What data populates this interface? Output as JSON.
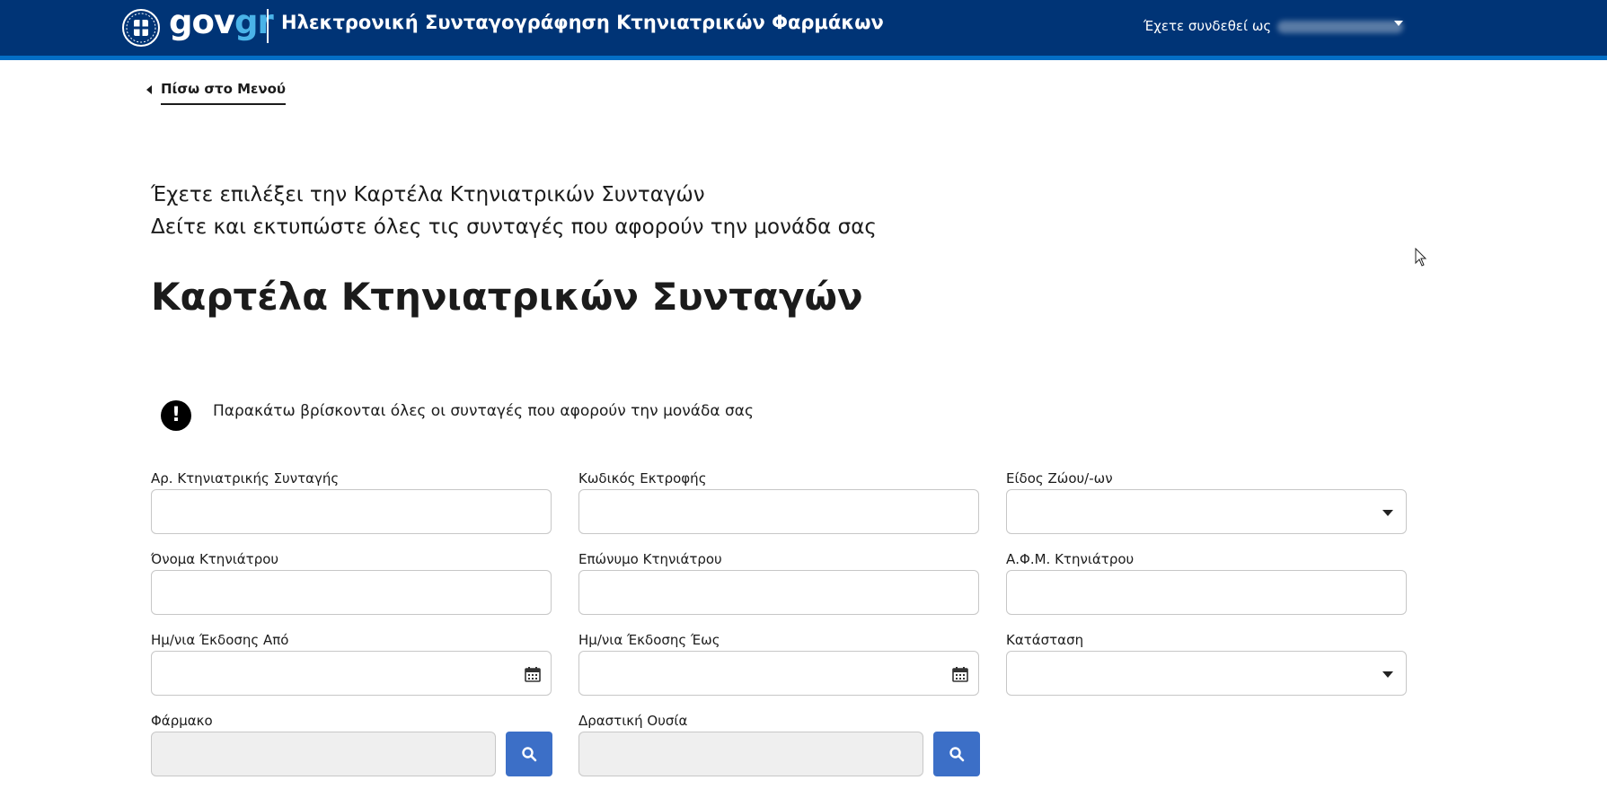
{
  "header": {
    "brand_gov": "gov",
    "brand_gr": "gr",
    "app_title": "Ηλεκτρονική Συνταγογράφηση Κτηνιατρικών Φαρμάκων",
    "signed_in_label": "Έχετε συνδεθεί ως",
    "colors": {
      "bar": "#003476",
      "strip": "#046ec5"
    }
  },
  "nav": {
    "back_label": "Πίσω στο Μενού"
  },
  "intro": {
    "line1": "Έχετε επιλέξει την Καρτέλα Κτηνιατρικών Συνταγών",
    "line2": "Δείτε και εκτυπώστε όλες τις συνταγές που αφορούν την μονάδα σας"
  },
  "page_title": "Καρτέλα Κτηνιατρικών Συνταγών",
  "notice": {
    "icon": "exclamation-icon",
    "text": "Παρακάτω βρίσκονται όλες οι συνταγές που αφορούν την μονάδα σας"
  },
  "form": {
    "prescription_number": {
      "label": "Αρ. Κτηνιατρικής Συνταγής",
      "value": ""
    },
    "farm_code": {
      "label": "Κωδικός Εκτροφής",
      "value": ""
    },
    "animal_species": {
      "label": "Είδος Ζώου/-ων",
      "value": ""
    },
    "vet_first_name": {
      "label": "Όνομα Κτηνιάτρου",
      "value": ""
    },
    "vet_last_name": {
      "label": "Επώνυμο Κτηνιάτρου",
      "value": ""
    },
    "vet_tax_id": {
      "label": "Α.Φ.Μ. Κτηνιάτρου",
      "value": ""
    },
    "issue_date_from": {
      "label": "Ημ/νια Έκδοσης Από",
      "value": ""
    },
    "issue_date_to": {
      "label": "Ημ/νια Έκδοσης Έως",
      "value": ""
    },
    "status": {
      "label": "Κατάσταση",
      "value": ""
    },
    "drug": {
      "label": "Φάρμακο",
      "value": ""
    },
    "active_substance": {
      "label": "Δραστική Ουσία",
      "value": ""
    },
    "search_button_color": "#3c6fc7"
  }
}
